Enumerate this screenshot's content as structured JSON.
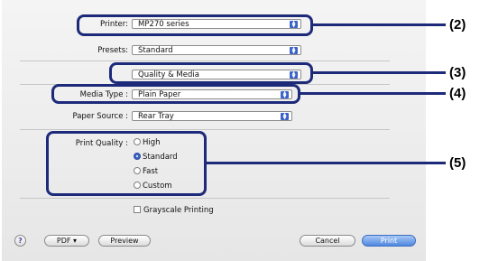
{
  "printer": {
    "label": "Printer:",
    "value": "MP270 series"
  },
  "presets": {
    "label": "Presets:",
    "value": "Standard"
  },
  "panel_menu": {
    "value": "Quality & Media"
  },
  "media_type": {
    "label": "Media Type :",
    "value": "Plain Paper"
  },
  "paper_source": {
    "label": "Paper Source :",
    "value": "Rear Tray"
  },
  "print_quality": {
    "label": "Print Quality :",
    "options": [
      "High",
      "Standard",
      "Fast",
      "Custom"
    ],
    "selected": "Standard"
  },
  "grayscale": {
    "label": "Grayscale Printing",
    "checked": false
  },
  "buttons": {
    "help": "?",
    "pdf": "PDF ▾",
    "preview": "Preview",
    "cancel": "Cancel",
    "print": "Print"
  },
  "callouts": [
    "(2)",
    "(3)",
    "(4)",
    "(5)"
  ],
  "colors": {
    "callout": "#1d2a7a",
    "accent": "#3b63c8"
  }
}
